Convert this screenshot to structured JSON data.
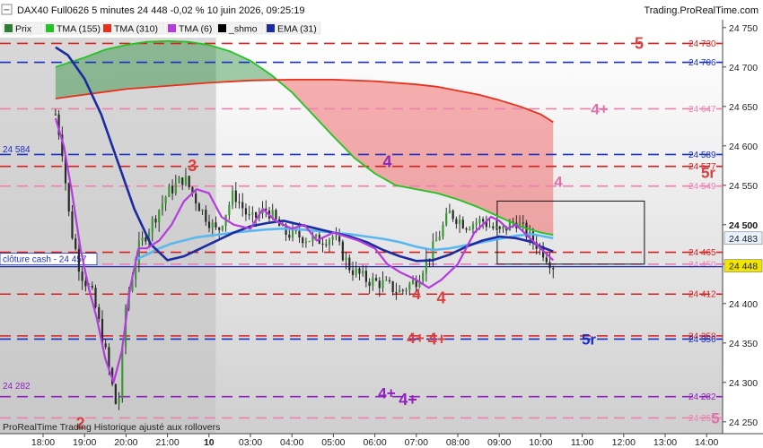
{
  "header": {
    "title": "DAX40 Full0626 5 minutes 24 448 -0,02 % 10 juin 2026, 09:25:19",
    "brand": "Trading.ProRealTime.com"
  },
  "legend": [
    {
      "label": "Prix",
      "color": "#2e7d32"
    },
    {
      "label": "TMA (155)",
      "color": "#22c322"
    },
    {
      "label": "TMA (310)",
      "color": "#e8301c"
    },
    {
      "label": "TMA (6)",
      "color": "#b43cdc"
    },
    {
      "label": "_shmo",
      "color": "#000000"
    },
    {
      "label": "EMA (31)",
      "color": "#1c2ca0"
    }
  ],
  "footer": "ProRealTime Trading  Historique ajusté aux rollovers",
  "cash_label": "clôture cash -  24 457",
  "price_badges": [
    {
      "value": "24 483",
      "bg": "#e8f2fc",
      "color": "#123"
    },
    {
      "value": "24 448",
      "bg": "#f2e600",
      "color": "#111"
    }
  ],
  "current_price_label": "24 500",
  "chart_data": {
    "type": "candlestick",
    "ylim": [
      24235,
      24760
    ],
    "y_ticks": [
      "24 250",
      "24 300",
      "24 350",
      "24 400",
      "24 450",
      "24 500",
      "24 550",
      "24 600",
      "24 650",
      "24 700",
      "24 750"
    ],
    "x_ticks": [
      "18:00",
      "19:00",
      "20:00",
      "21:00",
      "10",
      "03:00",
      "04:00",
      "05:00",
      "06:00",
      "07:00",
      "08:00",
      "09:00",
      "10:00",
      "11:00",
      "12:00",
      "13:00",
      "14:00"
    ],
    "levels": [
      {
        "value": 24730,
        "label": "24 730",
        "color": "#d92020",
        "dash": "long",
        "zone": "5",
        "zone_color": "#d94040"
      },
      {
        "value": 24706,
        "label": "24 706",
        "color": "#1a2fc8",
        "dash": "long"
      },
      {
        "value": 24647,
        "label": "24 647",
        "color": "#ee80b0",
        "dash": "long",
        "zone": "4+",
        "zone_color": "#e070a8"
      },
      {
        "value": 24589,
        "label": "24 589",
        "color": "#1a2fc8",
        "dash": "long"
      },
      {
        "value": 24574,
        "label": "24 577",
        "color": "#d92020",
        "dash": "long",
        "zone": "5r",
        "zone_color": "#d94040"
      },
      {
        "value": 24549,
        "label": "24 549",
        "color": "#ee80b0",
        "dash": "long",
        "zone": "4",
        "zone_color": "#e070a8"
      },
      {
        "value": 24465,
        "label": "24 465",
        "color": "#d92020",
        "dash": "long"
      },
      {
        "value": 24450,
        "label": "24 450",
        "color": "#ee80b0",
        "dash": "long"
      },
      {
        "value": 24412,
        "label": "24 412",
        "color": "#d92020",
        "dash": "long",
        "zone": "4",
        "zone_color": "#d94040"
      },
      {
        "value": 24359,
        "label": "24 358",
        "color": "#d92020",
        "dash": "long",
        "zone": "4+",
        "zone_color": "#d94040"
      },
      {
        "value": 24355,
        "label": "24 356",
        "color": "#1a2fc8",
        "dash": "long",
        "zone": "5r",
        "zone_color": "#1a2fc8"
      },
      {
        "value": 24282,
        "label": "24 282",
        "color": "#9020c0",
        "dash": "long",
        "zone": "4+",
        "zone_color": "#9020c0"
      },
      {
        "value": 24255,
        "label": "24 255",
        "color": "#ee80b0",
        "dash": "long",
        "zone": "5",
        "zone_color": "#e070a8"
      }
    ],
    "annotations": [
      {
        "text": "2",
        "color": "#d94040",
        "x": 0.9,
        "y": 24248
      },
      {
        "text": "3",
        "color": "#d94040",
        "x": 3.6,
        "y": 24575
      },
      {
        "text": "4",
        "color": "#8a2ab0",
        "x": 8.3,
        "y": 24580
      },
      {
        "text": "4",
        "color": "#d94040",
        "x": 9.6,
        "y": 24407
      },
      {
        "text": "4+",
        "color": "#d94040",
        "x": 9.5,
        "y": 24355
      },
      {
        "text": "4+",
        "color": "#9020c0",
        "x": 8.8,
        "y": 24278
      }
    ],
    "left_labels": [
      {
        "text": "24 584",
        "y": 24592
      },
      {
        "text": "24 282",
        "y": 24292
      }
    ],
    "series": [
      {
        "name": "TMA (155)",
        "color": "#22c322",
        "x": [
          -0.7,
          0,
          0.5,
          1,
          1.5,
          2,
          2.5,
          3,
          3.5,
          4,
          4.5,
          5,
          5.5,
          6,
          6.5,
          7,
          7.5,
          8,
          8.5,
          9,
          9.5,
          10,
          10.5,
          11,
          11.3
        ],
        "values": [
          24700,
          24712,
          24722,
          24728,
          24732,
          24733,
          24732,
          24728,
          24720,
          24708,
          24690,
          24668,
          24640,
          24612,
          24585,
          24565,
          24550,
          24545,
          24540,
          24532,
          24522,
          24510,
          24498,
          24490,
          24487
        ]
      },
      {
        "name": "TMA (310)",
        "color": "#e8301c",
        "x": [
          -0.7,
          0,
          1,
          2,
          3,
          4,
          5,
          6,
          7,
          8,
          8.5,
          9,
          9.5,
          10,
          10.5,
          11,
          11.3
        ],
        "values": [
          24660,
          24665,
          24672,
          24676,
          24680,
          24683,
          24684,
          24684,
          24682,
          24678,
          24675,
          24670,
          24665,
          24658,
          24650,
          24640,
          24630
        ]
      },
      {
        "name": "EMA (31)",
        "color": "#1c2ca0",
        "x": [
          -0.7,
          -0.4,
          0,
          0.4,
          0.8,
          1.2,
          1.6,
          2,
          2.4,
          2.8,
          3.2,
          3.6,
          4,
          4.4,
          4.8,
          5.2,
          5.6,
          6,
          6.4,
          6.8,
          7.2,
          7.6,
          8,
          8.4,
          8.8,
          9.2,
          9.6,
          10,
          10.4,
          10.8,
          11,
          11.3
        ],
        "values": [
          24725,
          24715,
          24685,
          24640,
          24580,
          24520,
          24475,
          24455,
          24460,
          24470,
          24480,
          24490,
          24498,
          24502,
          24505,
          24500,
          24495,
          24490,
          24485,
          24478,
          24468,
          24460,
          24454,
          24455,
          24462,
          24472,
          24480,
          24485,
          24483,
          24478,
          24472,
          24466
        ]
      },
      {
        "name": "TMA (6)",
        "color": "#b43cdc",
        "x": [
          -0.7,
          -0.5,
          -0.3,
          -0.1,
          0.1,
          0.3,
          0.5,
          0.7,
          0.9,
          1.1,
          1.3,
          1.5,
          1.8,
          2.1,
          2.4,
          2.7,
          3,
          3.3,
          3.6,
          4,
          4.3,
          4.6,
          5,
          5.3,
          5.6,
          6,
          6.3,
          6.6,
          7,
          7.3,
          7.6,
          8,
          8.3,
          8.6,
          9,
          9.2,
          9.4,
          9.6,
          9.8,
          10,
          10.2,
          10.4,
          10.6,
          10.8,
          11,
          11.3
        ],
        "values": [
          24635,
          24600,
          24540,
          24470,
          24420,
          24380,
          24330,
          24300,
          24340,
          24420,
          24470,
          24470,
          24480,
          24500,
          24530,
          24545,
          24540,
          24510,
          24500,
          24495,
          24520,
          24505,
          24495,
          24500,
          24480,
          24490,
          24485,
          24480,
          24470,
          24450,
          24440,
          24430,
          24420,
          24430,
          24450,
          24470,
          24490,
          24500,
          24510,
          24505,
          24495,
          24500,
          24490,
          24480,
          24470,
          24455
        ]
      },
      {
        "name": "_shmo",
        "color": "#5ab8f0",
        "x": [
          1.2,
          1.5,
          1.8,
          2.1,
          2.4,
          2.7,
          3,
          3.3,
          3.6,
          4,
          4.4,
          4.8,
          5.2,
          5.6,
          6,
          6.4,
          6.8,
          7.2,
          7.6,
          8,
          8.4,
          8.8,
          9.2,
          9.6,
          10,
          10.4,
          10.8,
          11,
          11.3
        ],
        "values": [
          24455,
          24462,
          24470,
          24476,
          24480,
          24484,
          24486,
          24488,
          24490,
          24492,
          24494,
          24495,
          24494,
          24492,
          24490,
          24488,
          24485,
          24482,
          24478,
          24472,
          24468,
          24470,
          24474,
          24478,
          24482,
          24486,
          24488,
          24486,
          24483
        ]
      }
    ],
    "candles": {
      "x_start": -0.7,
      "x_end": 11.3,
      "anchors": [
        {
          "x": -0.7,
          "p": 24640
        },
        {
          "x": -0.55,
          "p": 24600
        },
        {
          "x": -0.35,
          "p": 24500
        },
        {
          "x": -0.1,
          "p": 24440
        },
        {
          "x": 0.2,
          "p": 24410
        },
        {
          "x": 0.5,
          "p": 24340
        },
        {
          "x": 0.8,
          "p": 24260
        },
        {
          "x": 1.0,
          "p": 24400
        },
        {
          "x": 1.3,
          "p": 24470
        },
        {
          "x": 1.6,
          "p": 24500
        },
        {
          "x": 2.0,
          "p": 24540
        },
        {
          "x": 2.4,
          "p": 24560
        },
        {
          "x": 2.8,
          "p": 24520
        },
        {
          "x": 3.2,
          "p": 24490
        },
        {
          "x": 3.6,
          "p": 24540
        },
        {
          "x": 4.0,
          "p": 24505
        },
        {
          "x": 4.4,
          "p": 24520
        },
        {
          "x": 4.8,
          "p": 24490
        },
        {
          "x": 5.2,
          "p": 24485
        },
        {
          "x": 5.6,
          "p": 24480
        },
        {
          "x": 6.0,
          "p": 24485
        },
        {
          "x": 6.4,
          "p": 24445
        },
        {
          "x": 6.8,
          "p": 24430
        },
        {
          "x": 7.2,
          "p": 24425
        },
        {
          "x": 7.6,
          "p": 24415
        },
        {
          "x": 8.0,
          "p": 24430
        },
        {
          "x": 8.4,
          "p": 24470
        },
        {
          "x": 8.8,
          "p": 24515
        },
        {
          "x": 9.2,
          "p": 24500
        },
        {
          "x": 9.6,
          "p": 24505
        },
        {
          "x": 10.0,
          "p": 24490
        },
        {
          "x": 10.4,
          "p": 24505
        },
        {
          "x": 10.8,
          "p": 24480
        },
        {
          "x": 11.0,
          "p": 24470
        },
        {
          "x": 11.3,
          "p": 24448
        }
      ]
    },
    "highlight_box": {
      "x0": 9.95,
      "x1": 13.5,
      "y0": 24530,
      "y1": 24450
    },
    "cash_close": 24457
  }
}
